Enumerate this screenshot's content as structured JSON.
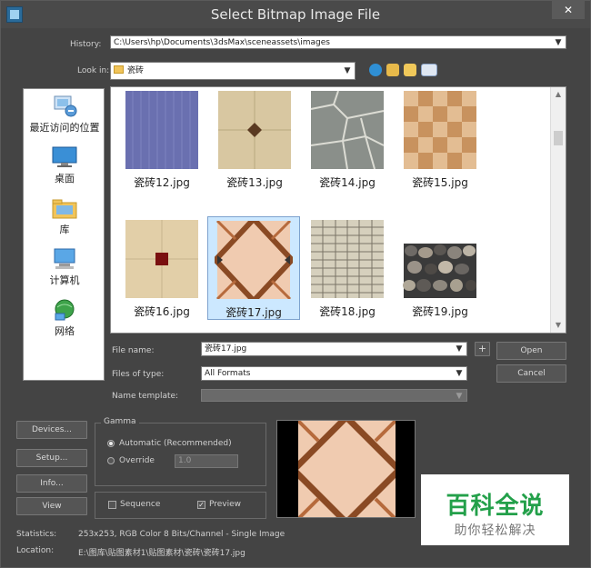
{
  "window": {
    "title": "Select Bitmap Image File",
    "close_glyph": "✕"
  },
  "history": {
    "label": "History:",
    "value": "C:\\Users\\hp\\Documents\\3dsMax\\sceneassets\\images"
  },
  "lookin": {
    "label": "Look in:",
    "value": "瓷砖"
  },
  "places": [
    {
      "label": "最近访问的位置",
      "icon": "recent-places-icon"
    },
    {
      "label": "桌面",
      "icon": "desktop-icon"
    },
    {
      "label": "库",
      "icon": "libraries-icon"
    },
    {
      "label": "计算机",
      "icon": "computer-icon"
    },
    {
      "label": "网络",
      "icon": "network-icon"
    }
  ],
  "files": [
    {
      "name": "瓷砖12.jpg",
      "pattern": "fabric-blue"
    },
    {
      "name": "瓷砖13.jpg",
      "pattern": "beige-diamond"
    },
    {
      "name": "瓷砖14.jpg",
      "pattern": "flagstone"
    },
    {
      "name": "瓷砖15.jpg",
      "pattern": "checker-brown"
    },
    {
      "name": "瓷砖16.jpg",
      "pattern": "marble-red-inset"
    },
    {
      "name": "瓷砖17.jpg",
      "pattern": "diamond-lattice",
      "selected": true
    },
    {
      "name": "瓷砖18.jpg",
      "pattern": "brick-stack"
    },
    {
      "name": "瓷砖19.jpg",
      "pattern": "pebbles"
    }
  ],
  "filename": {
    "label": "File name:",
    "value": "瓷砖17.jpg",
    "plus": "+"
  },
  "filetype": {
    "label": "Files of type:",
    "value": "All Formats"
  },
  "template": {
    "label": "Name template:",
    "value": ""
  },
  "buttons": {
    "open": "Open",
    "cancel": "Cancel",
    "devices": "Devices...",
    "setup": "Setup...",
    "info": "Info...",
    "view": "View"
  },
  "gamma": {
    "title": "Gamma",
    "automatic": "Automatic (Recommended)",
    "override": "Override",
    "override_value": "1.0"
  },
  "options": {
    "sequence": "Sequence",
    "preview": "Preview",
    "preview_checked": "✓"
  },
  "statistics": {
    "label": "Statistics:",
    "value": "253x253, RGB Color 8 Bits/Channel - Single Image"
  },
  "location": {
    "label": "Location:",
    "value": "E:\\图库\\贴图素材1\\贴图素材\\瓷砖\\瓷砖17.jpg"
  },
  "watermark": {
    "main": "百科全说",
    "sub": "助你轻松解决"
  },
  "colors": {
    "accent_green": "#23a04a",
    "selection": "#cce8ff"
  }
}
